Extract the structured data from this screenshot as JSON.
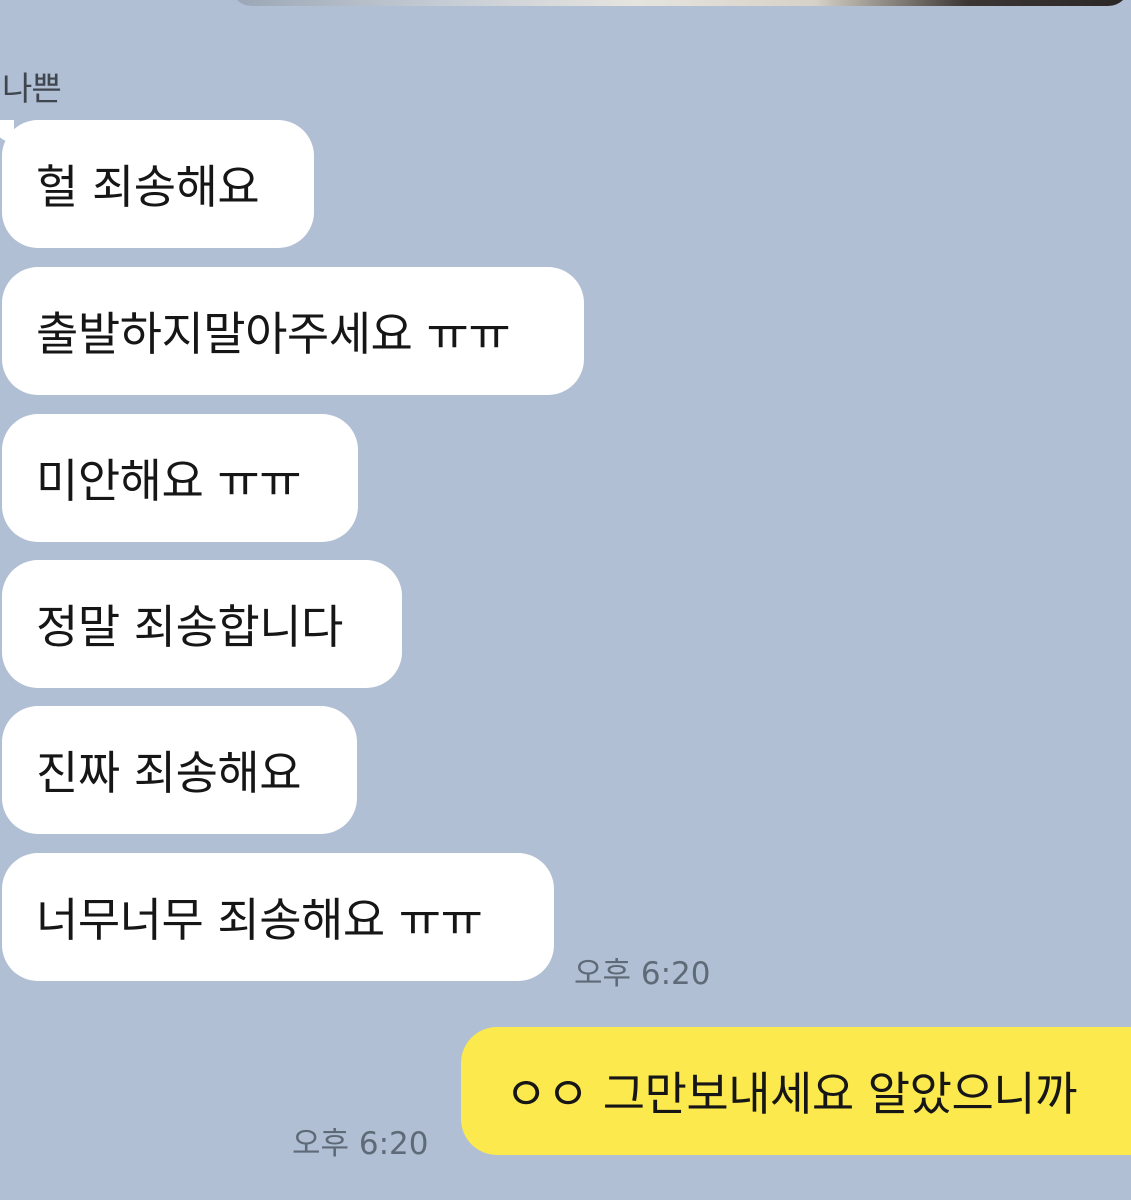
{
  "chat": {
    "sender_name": "나쁜",
    "incoming_messages": [
      "헐 죄송해요",
      "출발하지말아주세요 ㅠㅠ",
      "미안해요 ㅠㅠ",
      "정말 죄송합니다",
      "진짜 죄송해요",
      "너무너무 죄송해요 ㅠㅠ"
    ],
    "incoming_time": "오후 6:20",
    "outgoing_message": "ㅇㅇ 그만보내세요 알았으니까",
    "outgoing_time": "오후 6:20"
  },
  "colors": {
    "background": "#b0bfd3",
    "incoming_bubble": "#ffffff",
    "outgoing_bubble": "#fbe94d",
    "timestamp": "#5f6a78"
  }
}
